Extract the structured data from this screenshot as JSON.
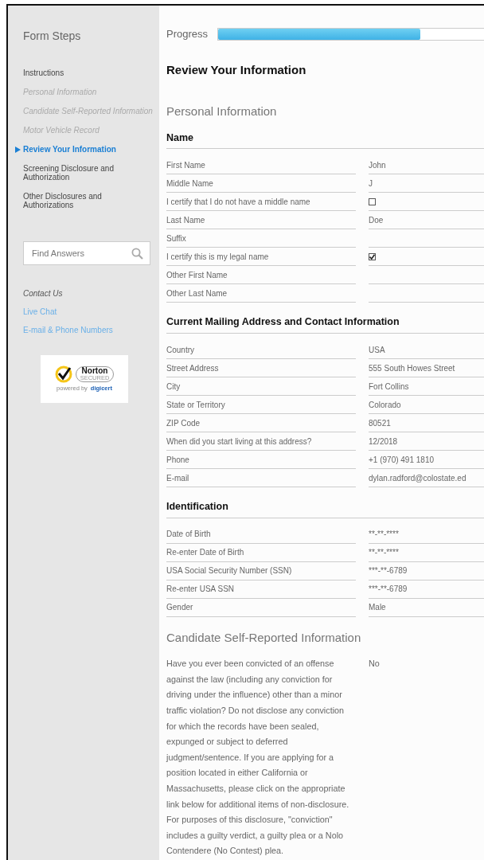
{
  "sidebar": {
    "title": "Form Steps",
    "steps": [
      {
        "label": "Instructions",
        "selected": false,
        "disabled": false
      },
      {
        "label": "Personal Information",
        "selected": false,
        "disabled": true
      },
      {
        "label": "Candidate Self-Reported Information",
        "selected": false,
        "disabled": true
      },
      {
        "label": "Motor Vehicle Record",
        "selected": false,
        "disabled": true
      },
      {
        "label": "Review Your Information",
        "selected": true,
        "disabled": false
      },
      {
        "label": "Screening Disclosure and Authorization",
        "selected": false,
        "disabled": false
      },
      {
        "label": "Other Disclosures and Authorizations",
        "selected": false,
        "disabled": false
      }
    ],
    "search": {
      "placeholder": "Find Answers"
    },
    "contact": {
      "title": "Contact Us",
      "links": [
        "Live Chat",
        "E-mail & Phone Numbers"
      ]
    },
    "badge": {
      "brand": "Norton",
      "tagline": "SECURED",
      "powered_by": "powered by",
      "vendor": "digicert"
    }
  },
  "progress": {
    "label": "Progress",
    "level": 0.76
  },
  "page_title": "Review Your Information",
  "sections": [
    {
      "title": "Personal Information",
      "groups": [
        {
          "title": "Name",
          "rows": [
            {
              "label": "First Name",
              "kind": "text",
              "value": "John"
            },
            {
              "label": "Middle Name",
              "kind": "text",
              "value": "J"
            },
            {
              "label": "I certify that I do not have a middle name",
              "kind": "checkbox",
              "checked": false
            },
            {
              "label": "Last Name",
              "kind": "text",
              "value": "Doe"
            },
            {
              "label": "Suffix",
              "kind": "text"
            },
            {
              "label": "I certify this is my legal name",
              "kind": "checkbox",
              "checked": true
            },
            {
              "label": "Other First Name",
              "kind": "text"
            },
            {
              "label": "Other Last Name",
              "kind": "text"
            }
          ]
        },
        {
          "title": "Current Mailing Address and Contact Information",
          "rows": [
            {
              "label": "Country",
              "kind": "text",
              "value": "USA"
            },
            {
              "label": "Street Address",
              "kind": "text",
              "value": "555 South Howes Street"
            },
            {
              "label": "City",
              "kind": "text",
              "value": "Fort Collins"
            },
            {
              "label": "State or Territory",
              "kind": "text",
              "value": "Colorado"
            },
            {
              "label": "ZIP Code",
              "kind": "text",
              "value": "80521"
            },
            {
              "label": "When did you start living at this address?",
              "kind": "text",
              "value": "12/2018"
            },
            {
              "label": "Phone",
              "kind": "text",
              "value": "+1 (970) 491 1810"
            },
            {
              "label": "E-mail",
              "kind": "text",
              "value": "dylan.radford@colostate.ed"
            }
          ]
        },
        {
          "title": "Identification",
          "rows": [
            {
              "label": "Date of Birth",
              "kind": "text",
              "value": "**-**-****"
            },
            {
              "label": "Re-enter Date of Birth",
              "kind": "text",
              "value": "**-**-****"
            },
            {
              "label": "USA Social Security Number (SSN)",
              "kind": "text",
              "value": "***-**-6789"
            },
            {
              "label": "Re-enter USA SSN",
              "kind": "text",
              "value": "***-**-6789"
            },
            {
              "label": "Gender",
              "kind": "text",
              "value": "Male"
            }
          ]
        }
      ]
    },
    {
      "title": "Candidate Self-Reported Information",
      "questions": [
        {
          "question": "Have you ever been convicted of an offense against the law (including any conviction for driving under the influence) other than a minor traffic violation? Do not disclose any conviction for which the records have been sealed, expunged or subject to deferred judgment/sentence. If you are applying for a position located in either California or Massachusetts, please click on the appropriate link below for additional items of non-disclosure. For purposes of this disclosure, \"conviction\" includes a guilty verdict, a guilty plea or a Nolo Contendere (No Contest) plea.",
          "answer": "No"
        }
      ]
    }
  ]
}
